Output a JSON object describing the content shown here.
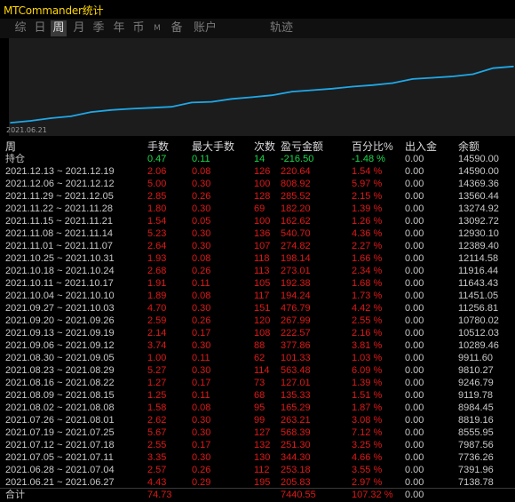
{
  "window": {
    "title": "MTCommander统计"
  },
  "tabs": [
    {
      "label": "综",
      "active": false
    },
    {
      "label": "日",
      "active": false
    },
    {
      "label": "周",
      "active": true
    },
    {
      "label": "月",
      "active": false
    },
    {
      "label": "季",
      "active": false
    },
    {
      "label": "年",
      "active": false
    },
    {
      "label": "币",
      "active": false
    },
    {
      "label": "M",
      "active": false
    },
    {
      "label": "备",
      "active": false
    },
    {
      "label": "账户",
      "active": false
    },
    {
      "label": "轨迹",
      "active": false
    }
  ],
  "chart": {
    "start_label": "2021.06.21",
    "line_color": "#1ea8e8",
    "background": "#1c1c1c"
  },
  "chart_data": {
    "type": "line",
    "x": [
      "2021.06.21",
      "2021.06.28",
      "2021.07.05",
      "2021.07.12",
      "2021.07.19",
      "2021.07.26",
      "2021.08.02",
      "2021.08.09",
      "2021.08.16",
      "2021.08.23",
      "2021.08.30",
      "2021.09.06",
      "2021.09.13",
      "2021.09.20",
      "2021.09.27",
      "2021.10.04",
      "2021.10.11",
      "2021.10.18",
      "2021.10.25",
      "2021.11.01",
      "2021.11.08",
      "2021.11.15",
      "2021.11.22",
      "2021.11.29",
      "2021.12.06",
      "2021.12.13"
    ],
    "series": [
      {
        "values": [
          7138.78,
          7391.96,
          7736.26,
          7987.56,
          8555.95,
          8819.16,
          8984.45,
          9119.78,
          9246.79,
          9810.27,
          9911.6,
          10289.46,
          10512.03,
          10780.02,
          11256.81,
          11451.05,
          11643.43,
          11916.44,
          12114.58,
          12389.4,
          12930.1,
          13092.72,
          13274.92,
          13560.41,
          14369.36,
          14590.0
        ]
      }
    ]
  },
  "table": {
    "headers": [
      "周",
      "手数",
      "最大手数",
      "次数",
      "盈亏金额",
      "百分比%",
      "出入金",
      "余额"
    ],
    "holding": {
      "label": "持仓",
      "lots": "0.47",
      "max_lots": "0.11",
      "count": "14",
      "pnl": "-216.50",
      "pct": "-1.48 %",
      "flow": "0.00",
      "balance": "14590.00"
    },
    "rows": [
      {
        "week": "2021.12.13 ~ 2021.12.19",
        "lots": "2.06",
        "max_lots": "0.08",
        "count": "126",
        "pnl": "220.64",
        "pct": "1.54 %",
        "flow": "0.00",
        "balance": "14590.00"
      },
      {
        "week": "2021.12.06 ~ 2021.12.12",
        "lots": "5.00",
        "max_lots": "0.30",
        "count": "100",
        "pnl": "808.92",
        "pct": "5.97 %",
        "flow": "0.00",
        "balance": "14369.36"
      },
      {
        "week": "2021.11.29 ~ 2021.12.05",
        "lots": "2.85",
        "max_lots": "0.26",
        "count": "128",
        "pnl": "285.52",
        "pct": "2.15 %",
        "flow": "0.00",
        "balance": "13560.44"
      },
      {
        "week": "2021.11.22 ~ 2021.11.28",
        "lots": "1.80",
        "max_lots": "0.30",
        "count": "69",
        "pnl": "182.20",
        "pct": "1.39 %",
        "flow": "0.00",
        "balance": "13274.92"
      },
      {
        "week": "2021.11.15 ~ 2021.11.21",
        "lots": "1.54",
        "max_lots": "0.05",
        "count": "100",
        "pnl": "162.62",
        "pct": "1.26 %",
        "flow": "0.00",
        "balance": "13092.72"
      },
      {
        "week": "2021.11.08 ~ 2021.11.14",
        "lots": "5.23",
        "max_lots": "0.30",
        "count": "136",
        "pnl": "540.70",
        "pct": "4.36 %",
        "flow": "0.00",
        "balance": "12930.10"
      },
      {
        "week": "2021.11.01 ~ 2021.11.07",
        "lots": "2.64",
        "max_lots": "0.30",
        "count": "107",
        "pnl": "274.82",
        "pct": "2.27 %",
        "flow": "0.00",
        "balance": "12389.40"
      },
      {
        "week": "2021.10.25 ~ 2021.10.31",
        "lots": "1.93",
        "max_lots": "0.08",
        "count": "118",
        "pnl": "198.14",
        "pct": "1.66 %",
        "flow": "0.00",
        "balance": "12114.58"
      },
      {
        "week": "2021.10.18 ~ 2021.10.24",
        "lots": "2.68",
        "max_lots": "0.26",
        "count": "113",
        "pnl": "273.01",
        "pct": "2.34 %",
        "flow": "0.00",
        "balance": "11916.44"
      },
      {
        "week": "2021.10.11 ~ 2021.10.17",
        "lots": "1.91",
        "max_lots": "0.11",
        "count": "105",
        "pnl": "192.38",
        "pct": "1.68 %",
        "flow": "0.00",
        "balance": "11643.43"
      },
      {
        "week": "2021.10.04 ~ 2021.10.10",
        "lots": "1.89",
        "max_lots": "0.08",
        "count": "117",
        "pnl": "194.24",
        "pct": "1.73 %",
        "flow": "0.00",
        "balance": "11451.05"
      },
      {
        "week": "2021.09.27 ~ 2021.10.03",
        "lots": "4.70",
        "max_lots": "0.30",
        "count": "151",
        "pnl": "476.79",
        "pct": "4.42 %",
        "flow": "0.00",
        "balance": "11256.81"
      },
      {
        "week": "2021.09.20 ~ 2021.09.26",
        "lots": "2.59",
        "max_lots": "0.26",
        "count": "120",
        "pnl": "267.99",
        "pct": "2.55 %",
        "flow": "0.00",
        "balance": "10780.02"
      },
      {
        "week": "2021.09.13 ~ 2021.09.19",
        "lots": "2.14",
        "max_lots": "0.17",
        "count": "108",
        "pnl": "222.57",
        "pct": "2.16 %",
        "flow": "0.00",
        "balance": "10512.03"
      },
      {
        "week": "2021.09.06 ~ 2021.09.12",
        "lots": "3.74",
        "max_lots": "0.30",
        "count": "88",
        "pnl": "377.86",
        "pct": "3.81 %",
        "flow": "0.00",
        "balance": "10289.46"
      },
      {
        "week": "2021.08.30 ~ 2021.09.05",
        "lots": "1.00",
        "max_lots": "0.11",
        "count": "62",
        "pnl": "101.33",
        "pct": "1.03 %",
        "flow": "0.00",
        "balance": "9911.60"
      },
      {
        "week": "2021.08.23 ~ 2021.08.29",
        "lots": "5.27",
        "max_lots": "0.30",
        "count": "114",
        "pnl": "563.48",
        "pct": "6.09 %",
        "flow": "0.00",
        "balance": "9810.27"
      },
      {
        "week": "2021.08.16 ~ 2021.08.22",
        "lots": "1.27",
        "max_lots": "0.17",
        "count": "73",
        "pnl": "127.01",
        "pct": "1.39 %",
        "flow": "0.00",
        "balance": "9246.79"
      },
      {
        "week": "2021.08.09 ~ 2021.08.15",
        "lots": "1.25",
        "max_lots": "0.11",
        "count": "68",
        "pnl": "135.33",
        "pct": "1.51 %",
        "flow": "0.00",
        "balance": "9119.78"
      },
      {
        "week": "2021.08.02 ~ 2021.08.08",
        "lots": "1.58",
        "max_lots": "0.08",
        "count": "95",
        "pnl": "165.29",
        "pct": "1.87 %",
        "flow": "0.00",
        "balance": "8984.45"
      },
      {
        "week": "2021.07.26 ~ 2021.08.01",
        "lots": "2.62",
        "max_lots": "0.30",
        "count": "99",
        "pnl": "263.21",
        "pct": "3.08 %",
        "flow": "0.00",
        "balance": "8819.16"
      },
      {
        "week": "2021.07.19 ~ 2021.07.25",
        "lots": "5.67",
        "max_lots": "0.30",
        "count": "127",
        "pnl": "568.39",
        "pct": "7.12 %",
        "flow": "0.00",
        "balance": "8555.95"
      },
      {
        "week": "2021.07.12 ~ 2021.07.18",
        "lots": "2.55",
        "max_lots": "0.17",
        "count": "132",
        "pnl": "251.30",
        "pct": "3.25 %",
        "flow": "0.00",
        "balance": "7987.56"
      },
      {
        "week": "2021.07.05 ~ 2021.07.11",
        "lots": "3.35",
        "max_lots": "0.30",
        "count": "130",
        "pnl": "344.30",
        "pct": "4.66 %",
        "flow": "0.00",
        "balance": "7736.26"
      },
      {
        "week": "2021.06.28 ~ 2021.07.04",
        "lots": "2.57",
        "max_lots": "0.26",
        "count": "112",
        "pnl": "253.18",
        "pct": "3.55 %",
        "flow": "0.00",
        "balance": "7391.96"
      },
      {
        "week": "2021.06.21 ~ 2021.06.27",
        "lots": "4.43",
        "max_lots": "0.29",
        "count": "195",
        "pnl": "205.83",
        "pct": "2.97 %",
        "flow": "0.00",
        "balance": "7138.78"
      }
    ],
    "total": {
      "label": "合计",
      "lots": "74.73",
      "pnl": "7440.55",
      "pct": "107.32 %",
      "flow": "0.00"
    }
  }
}
